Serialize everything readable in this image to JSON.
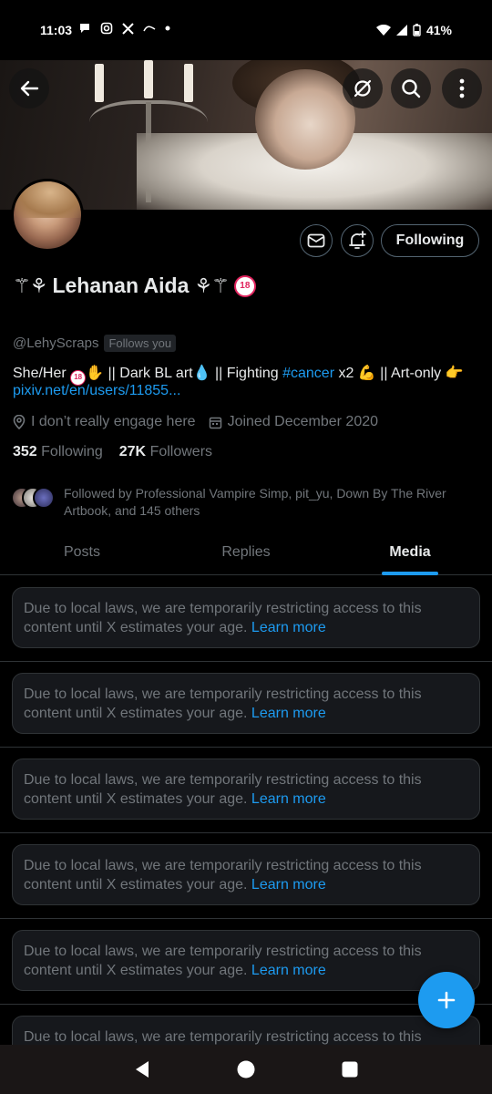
{
  "status_bar": {
    "time": "11:03",
    "notification_icons": [
      "chat-bubble-icon",
      "instagram-icon",
      "x-logo-icon",
      "app-icon",
      "dot-icon"
    ],
    "battery": "41%"
  },
  "banner": {
    "buttons": [
      "back-arrow-icon",
      "translate-off-icon",
      "search-icon",
      "more-vertical-icon"
    ]
  },
  "profile": {
    "display_name": "Lehanan Aida",
    "name_badge": "18",
    "handle": "@LehyScraps",
    "follows_you": "Follows you",
    "bio_part1": "She/Her ",
    "bio_part2": " || Dark BL art",
    "bio_part3": " || Fighting ",
    "bio_hashtag": "#cancer",
    "bio_part4": " x2 ",
    "bio_part5": " || Art-only ",
    "bio_link": "pixiv.net/en/users/11855...",
    "location": "I don’t really engage here",
    "joined": "Joined December 2020",
    "following_count": "352",
    "following_label": "Following",
    "followers_count": "27K",
    "followers_label": "Followers",
    "followed_by": "Followed by Professional Vampire Simp, pit_yu, Down By The River Artbook, and 145 others"
  },
  "actions": {
    "following_button": "Following"
  },
  "tabs": [
    {
      "label": "Posts",
      "active": false
    },
    {
      "label": "Replies",
      "active": false
    },
    {
      "label": "Media",
      "active": true
    }
  ],
  "feed": {
    "notice_text": "Due to local laws, we are temporarily restricting access to this content until X estimates your age.",
    "learn_more": "Learn more",
    "count": 6
  },
  "colors": {
    "accent": "#1d9bf0",
    "background": "#000000",
    "text_primary": "#e7e9ea",
    "text_secondary": "#71767b",
    "border": "#2f3336"
  }
}
